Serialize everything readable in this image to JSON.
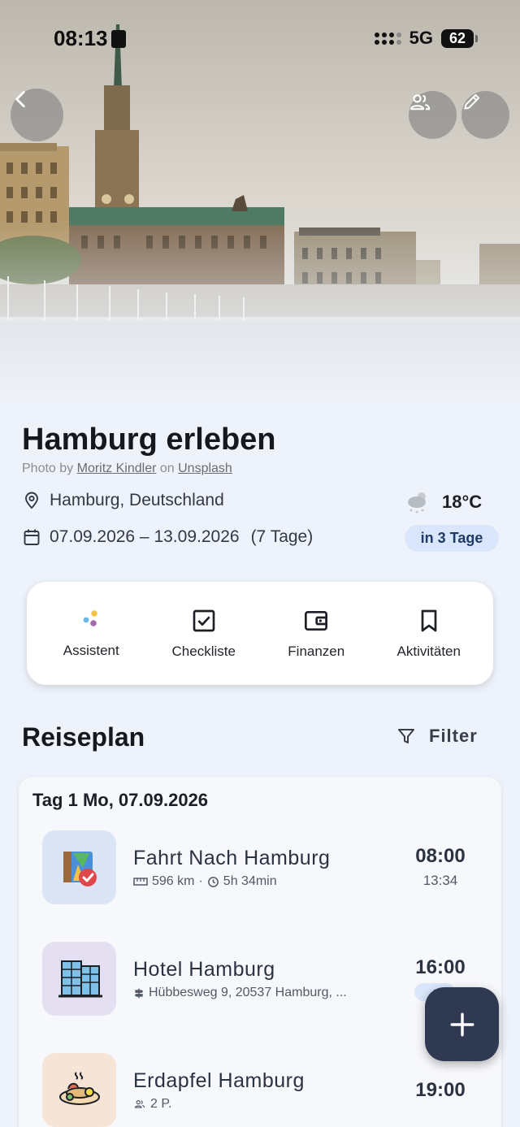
{
  "status_bar": {
    "time": "08:13",
    "network": "5G",
    "battery": "62"
  },
  "hero": {
    "back_icon": "chevron-left-icon",
    "members_icon": "people-icon",
    "edit_icon": "pencil-icon"
  },
  "trip": {
    "title": "Hamburg erleben",
    "photo_credit_prefix": "Photo by",
    "photographer": "Moritz Kindler",
    "credit_on": "on",
    "source": "Unsplash",
    "location": "Hamburg, Deutschland",
    "dates": "07.09.2026 – 13.09.2026",
    "duration": "(7 Tage)",
    "temperature": "18°C",
    "countdown": "in 3 Tage"
  },
  "quick_actions": [
    {
      "label": "Assistent",
      "icon": "assistant-dots-icon"
    },
    {
      "label": "Checkliste",
      "icon": "checkbox-icon"
    },
    {
      "label": "Finanzen",
      "icon": "wallet-icon"
    },
    {
      "label": "Aktivitäten",
      "icon": "bookmark-icon"
    }
  ],
  "itinerary": {
    "title": "Reiseplan",
    "filter_label": "Filter",
    "day": {
      "title": "Tag 1 Mo, 07.09.2026",
      "entries": [
        {
          "name": "Fahrt Nach Hamburg",
          "distance": "596 km",
          "sep": "·",
          "duration": "5h 34min",
          "time": "08:00",
          "end_time": "13:34"
        },
        {
          "name": "Hotel Hamburg",
          "address": "Hübbesweg 9, 20537 Hamburg, ...",
          "time": "16:00",
          "badge": "+"
        },
        {
          "name": "Erdapfel Hamburg",
          "people": "2 P.",
          "time": "19:00"
        }
      ]
    }
  },
  "colors": {
    "accent": "#2f3a52",
    "badge_bg": "#d9e6fb",
    "background": "#eef2fa"
  }
}
